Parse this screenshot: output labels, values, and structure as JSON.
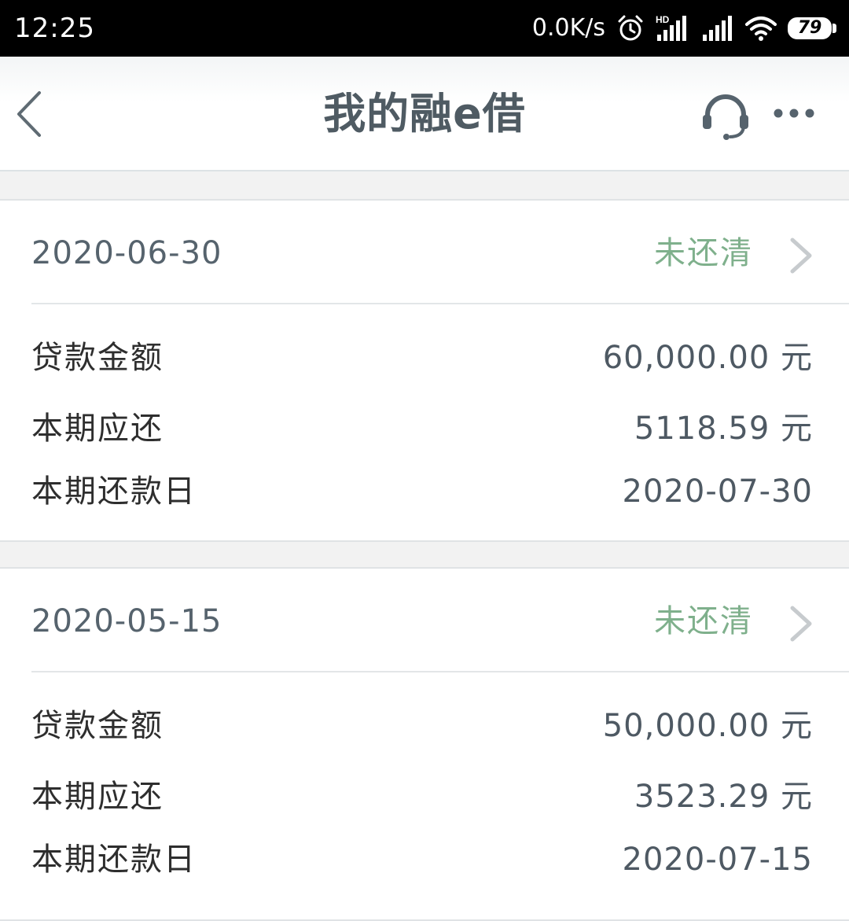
{
  "status_bar": {
    "time": "12:25",
    "net_speed": "0.0K/s",
    "hd_label": "HD",
    "battery": "79",
    "icons": [
      "alarm-icon",
      "hd-signal-icon",
      "signal-icon",
      "wifi-icon",
      "battery-icon"
    ]
  },
  "header": {
    "title": "我的融e借",
    "back_icon": "chevron-left-icon",
    "support_icon": "headset-icon",
    "more_icon": "more-dots-icon"
  },
  "colors": {
    "status_unpaid": "#7fb08c",
    "title": "#4f5b63",
    "date": "#56636d"
  },
  "loans": [
    {
      "date": "2020-06-30",
      "status": "未还清",
      "rows": [
        {
          "label": "贷款金额",
          "value": "60,000.00 元"
        },
        {
          "label": "本期应还",
          "value": "5118.59 元"
        },
        {
          "label": "本期还款日",
          "value": "2020-07-30"
        }
      ]
    },
    {
      "date": "2020-05-15",
      "status": "未还清",
      "rows": [
        {
          "label": "贷款金额",
          "value": "50,000.00 元"
        },
        {
          "label": "本期应还",
          "value": "3523.29 元"
        },
        {
          "label": "本期还款日",
          "value": "2020-07-15"
        }
      ]
    }
  ]
}
